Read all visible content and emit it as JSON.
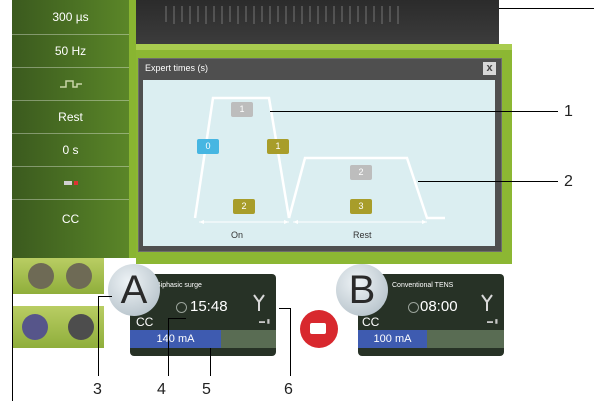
{
  "left_panel": {
    "rows": [
      {
        "label": "300 µs"
      },
      {
        "label": "50 Hz"
      },
      {
        "label": ""
      },
      {
        "label": "Rest"
      },
      {
        "label": "0 s"
      },
      {
        "label": ""
      },
      {
        "label": "CC"
      }
    ]
  },
  "expert": {
    "title": "Expert times (s)",
    "close": "x",
    "boxes": {
      "b0": "0",
      "b1_top": "1",
      "b1_right": "1",
      "b2_left": "2",
      "b2_right": "2",
      "b3": "3"
    },
    "labels": {
      "on": "On",
      "rest": "Rest"
    }
  },
  "channels": {
    "a": {
      "letter": "A",
      "title": "Biphasic surge",
      "time": "15:48",
      "mode": "CC",
      "current": "140 mA",
      "fill_fraction": 0.62
    },
    "b": {
      "letter": "B",
      "title": "Conventional TENS",
      "time": "08:00",
      "mode": "CC",
      "current": "100 mA",
      "fill_fraction": 0.47
    }
  },
  "callouts": {
    "c1": "1",
    "c2": "2",
    "c3": "3",
    "c4": "4",
    "c5": "5",
    "c6": "6"
  },
  "colors": {
    "accent_green": "#8cb733",
    "bar_blue": "#3e5bb0"
  }
}
